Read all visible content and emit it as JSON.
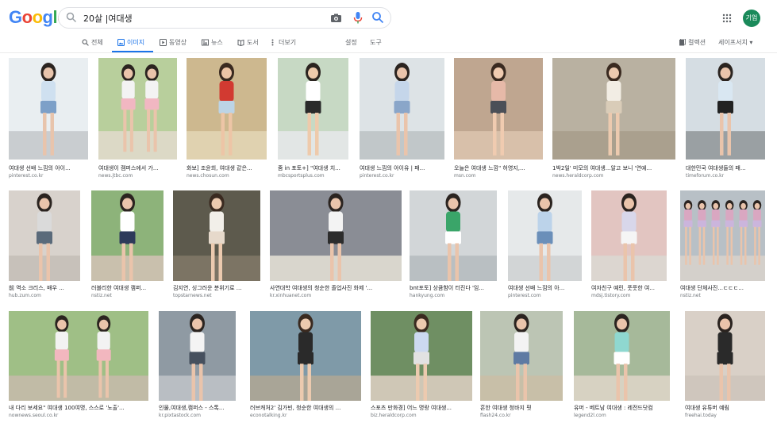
{
  "brand": {
    "logo_letters": [
      "G",
      "o",
      "o",
      "g",
      "l",
      "e"
    ],
    "logo_colors": [
      "#4285f4",
      "#ea4335",
      "#fbbc05",
      "#4285f4",
      "#34a853",
      "#ea4335"
    ]
  },
  "search": {
    "query": "20살 |여대생",
    "icons": [
      "search-icon",
      "camera-icon",
      "mic-icon",
      "search-button-icon"
    ]
  },
  "header": {
    "apps_icon": "apps-grid-icon",
    "avatar_text": "기업",
    "avatar_color": "#1a8a5a"
  },
  "tabs": {
    "items": [
      {
        "label": "전체",
        "icon": "search-icon"
      },
      {
        "label": "이미지",
        "icon": "image-icon"
      },
      {
        "label": "동영상",
        "icon": "video-icon"
      },
      {
        "label": "뉴스",
        "icon": "news-icon"
      },
      {
        "label": "도서",
        "icon": "book-icon"
      },
      {
        "label": "더보기",
        "icon": "more-icon"
      },
      {
        "label": "설정",
        "icon": ""
      },
      {
        "label": "도구",
        "icon": ""
      }
    ],
    "active": "이미지",
    "collections": "컬렉션",
    "safesearch": "세이프서치 ▾",
    "accent": "#1a73e8"
  },
  "results": [
    {
      "caption": "여대생 선배 느낌의 아이...",
      "source": "pinterest.co.kr"
    },
    {
      "caption": "여대생이 캠퍼스에서 가...",
      "source": "news.jtbc.com"
    },
    {
      "caption": "화보] 조윤희, 여대생 같은...",
      "source": "news.chosun.com"
    },
    {
      "caption": "줌 in 포토+] \"여대생 치...",
      "source": "mbcsportsplus.com"
    },
    {
      "caption": "여대생 느낌의 아이유 | 패...",
      "source": "pinterest.co.kr"
    },
    {
      "caption": "오늘은 여대생 느낌\" 허영지,...",
      "source": "msn.com"
    },
    {
      "caption": "1박2일' 미모의 여대생...알고 보니 '연예...",
      "source": "news.heraldcorp.com"
    },
    {
      "caption": "대한민국 여대생들의 패...",
      "source": "timeforum.co.kr"
    },
    {
      "caption": "前 역소 크리스, 배우 ...",
      "source": "hub.zum.com"
    },
    {
      "caption": "러블리한 여대생 캠퍼...",
      "source": "nstiz.net"
    },
    {
      "caption": "김지연, 싱그러운 분위기로 ...",
      "source": "topstarnews.net"
    },
    {
      "caption": "사연대학 여대생의 청순한 졸업사진 화제 '...",
      "source": "kr.xinhuanet.com"
    },
    {
      "caption": "bnt포토] 상큼함이 터진다 '임...",
      "source": "hankyung.com"
    },
    {
      "caption": "여대생 선배 느낌의 아...",
      "source": "pinterest.com"
    },
    {
      "caption": "여자친구 예린, 풋풋한 여...",
      "source": "mdsj.tistory.com"
    },
    {
      "caption": "여대생 단체사진...ㄷㄷㄷ...",
      "source": "nstiz.net"
    },
    {
      "caption": "내 다리 보세요\" 여대생 100여명, 스스로 '노출'...",
      "source": "nownews.seoul.co.kr"
    },
    {
      "caption": "인물,여대생,캠퍼스 - 스톡...",
      "source": "kr.pixtastock.com"
    },
    {
      "caption": "러브캐처2' 김가빈, 청순한 여대생의 ...",
      "source": "econotalking.kr"
    },
    {
      "caption": "스포츠 만화경] 어느 명랑 여대생...",
      "source": "biz.heraldcorp.com"
    },
    {
      "caption": "흔한 여대생 청바지 핏",
      "source": "flash24.co.kr"
    },
    {
      "caption": "유머 - 베트남 여대생 : 레전드닷컴",
      "source": "legend2l.com"
    },
    {
      "caption": "여대생 유튜버 예림",
      "source": "freehai.today"
    }
  ]
}
